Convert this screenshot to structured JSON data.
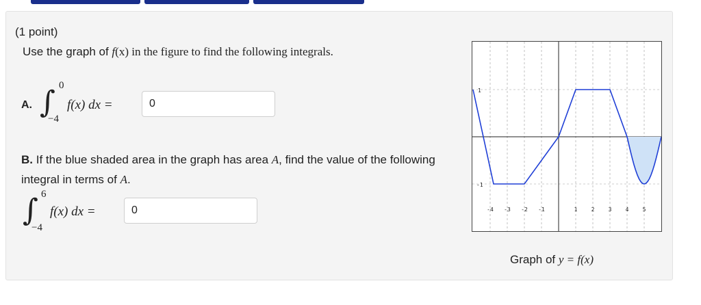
{
  "question": {
    "points_label": "(1 point)",
    "prompt_pre": "Use the graph of ",
    "prompt_func": "f",
    "prompt_post": "(x) in the figure to find the following integrals.",
    "part_a": {
      "label": "A.",
      "upper_limit": "0",
      "lower_limit": "−4",
      "integrand": "f(x) dx =",
      "answer_value": "0"
    },
    "part_b": {
      "bold_label": "B.",
      "text_1": " If the blue shaded area in the graph has area ",
      "var_a": "A",
      "text_2": ", find the value of the following integral in terms of ",
      "var_a2": "A",
      "text_3": ".",
      "upper_limit": "6",
      "lower_limit": "−4",
      "integrand": "f(x) dx =",
      "answer_value": "0"
    }
  },
  "graph": {
    "caption_prefix": "Graph of ",
    "caption_math": "y = f(x)",
    "y_tick_labels": [
      "1",
      "-1"
    ],
    "x_tick_labels": [
      "-4",
      "-3",
      "-2",
      "-1",
      "1",
      "2",
      "3",
      "4",
      "5"
    ],
    "curve_color": "#1f3fd6",
    "shade_color": "#cfe2f7",
    "grid_color": "#999999"
  }
}
